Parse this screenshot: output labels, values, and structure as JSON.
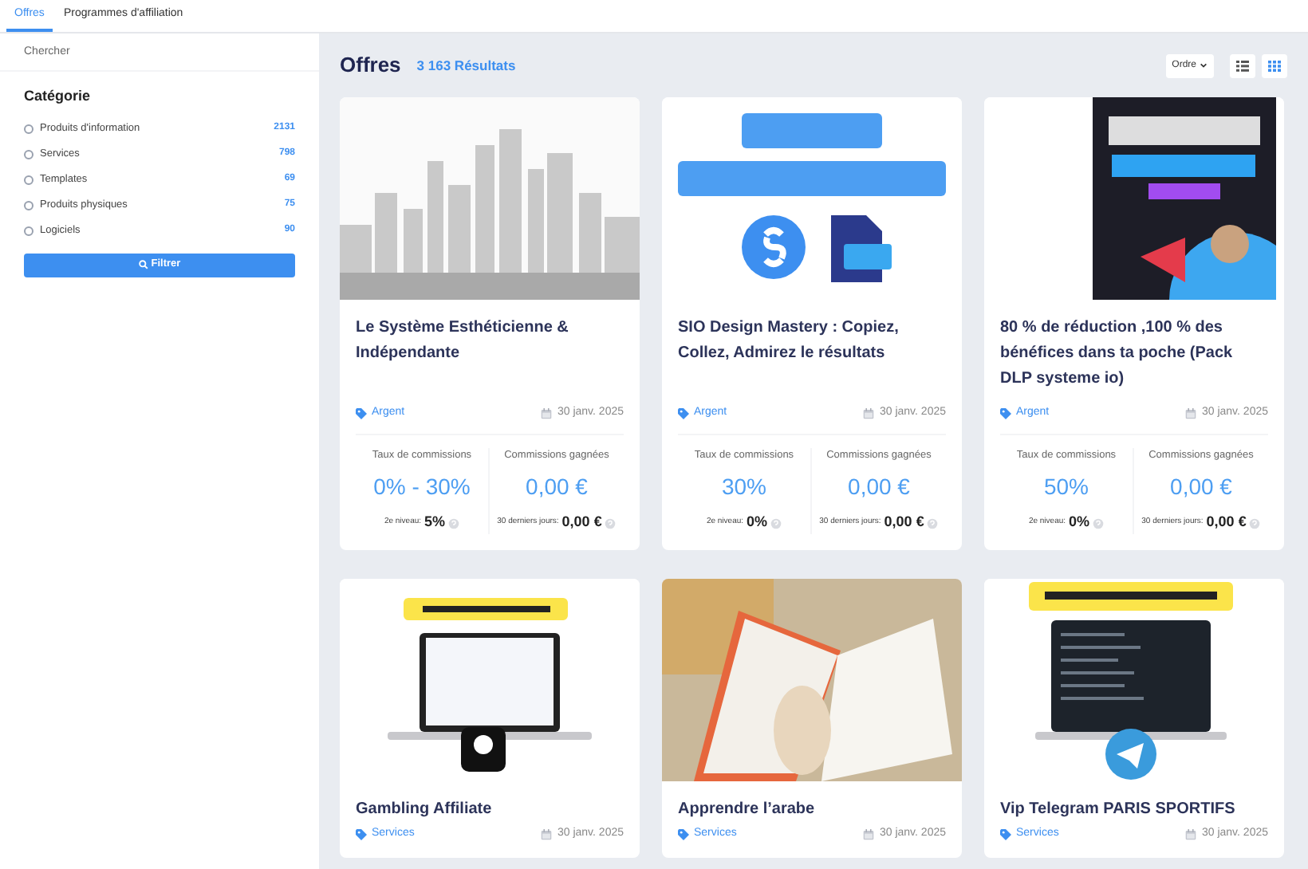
{
  "tabs": [
    {
      "label": "Offres",
      "selected": true
    },
    {
      "label": "Programmes d'affiliation",
      "selected": false
    }
  ],
  "sidebar": {
    "search": {
      "placeholder": "Chercher"
    },
    "heading": "Catégorie",
    "categories": [
      {
        "label": "Produits d'information",
        "count": "2131",
        "selected": false
      },
      {
        "label": "Services",
        "count": "798",
        "selected": false
      },
      {
        "label": "Templates",
        "count": "69",
        "selected": false
      },
      {
        "label": "Produits physiques",
        "count": "75",
        "selected": false
      },
      {
        "label": "Logiciels",
        "count": "90",
        "selected": false
      }
    ],
    "filter_button": "Filtrer"
  },
  "header": {
    "title": "Offres",
    "results": "3 163 Résultats",
    "sort": "Ordre",
    "view_buttons": [
      {
        "kind": "list",
        "selected": false
      },
      {
        "kind": "grid",
        "selected": true
      }
    ]
  },
  "offers": [
    {
      "kind": "skyline",
      "title": "Le Système Esthéticienne & Indépendante",
      "tag": "Argent",
      "date": "30 janv. 2025",
      "rate_label": "Taux de commissions",
      "rate": "0% - 30%",
      "level2_label": "2e niveau:",
      "level2": "5%",
      "earned_label": "Commissions gagnées",
      "earned": "0,00 €",
      "recent_label": "30 derniers jours:",
      "recent": "0,00 €"
    },
    {
      "kind": "logo",
      "title": "SIO Design Mastery : Copiez, Collez, Admirez le résultats",
      "tag": "Argent",
      "date": "30 janv. 2025",
      "rate_label": "Taux de commissions",
      "rate": "30%",
      "level2_label": "2e niveau:",
      "level2": "0%",
      "earned_label": "Commissions gagnées",
      "earned": "0,00 €",
      "recent_label": "30 derniers jours:",
      "recent": "0,00 €"
    },
    {
      "kind": "box",
      "title": "80 % de réduction ,100 % des bénéfices dans ta poche (Pack DLP systeme io)",
      "tag": "Argent",
      "date": "30 janv. 2025",
      "rate_label": "Taux de commissions",
      "rate": "50%",
      "level2_label": "2e niveau:",
      "level2": "0%",
      "earned_label": "Commissions gagnées",
      "earned": "0,00 €",
      "recent_label": "30 derniers jours:",
      "recent": "0,00 €"
    },
    {
      "kind": "laptop-light",
      "title": "Gambling Affiliate",
      "tag": "Services",
      "date": "30 janv. 2025"
    },
    {
      "kind": "photo",
      "title": "Apprendre l’arabe",
      "tag": "Services",
      "date": "30 janv. 2025"
    },
    {
      "kind": "laptop-dark",
      "title": "Vip Telegram PARIS SPORTIFS",
      "tag": "Services",
      "date": "30 janv. 2025"
    }
  ]
}
